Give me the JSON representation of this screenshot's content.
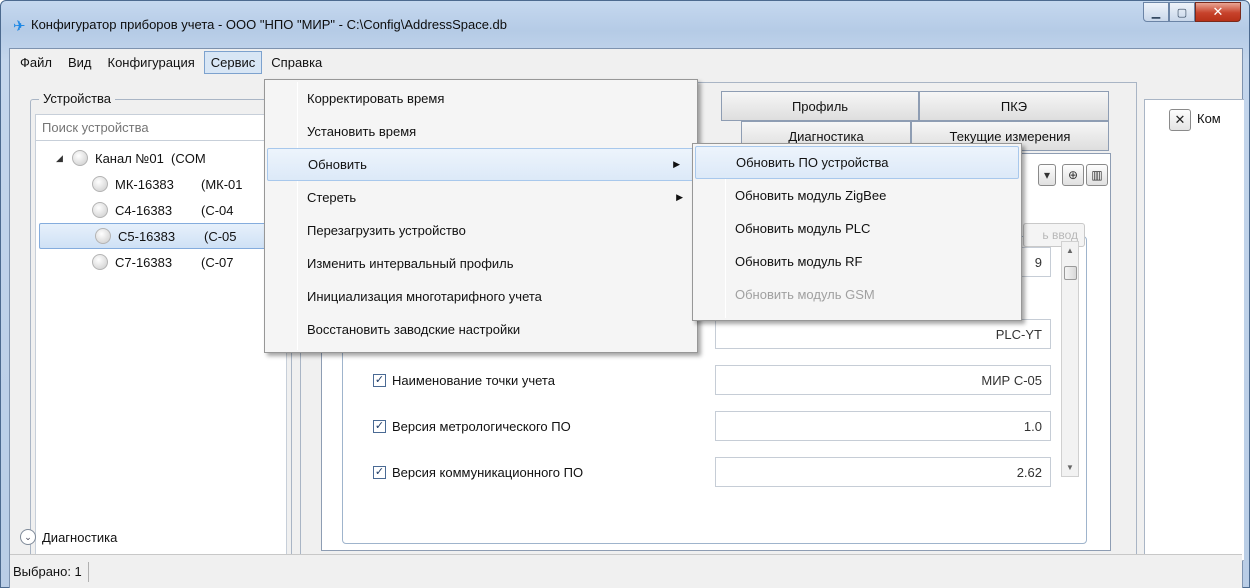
{
  "window": {
    "title": "Конфигуратор приборов учета - ООО \"НПО \"МИР\" - C:\\Config\\AddressSpace.db",
    "minimize_glyph": "▁",
    "maximize_glyph": "▢",
    "close_glyph": "✕"
  },
  "menubar": [
    "Файл",
    "Вид",
    "Конфигурация",
    "Сервис",
    "Справка"
  ],
  "devices": {
    "group_label": "Устройства",
    "search_placeholder": "Поиск устройства",
    "channel": {
      "name": "Канал №01",
      "port": "(COM"
    },
    "items": [
      {
        "name": "МК-16383",
        "port": "(МК-01"
      },
      {
        "name": "С4-16383",
        "port": "(С-04"
      },
      {
        "name": "С5-16383",
        "port": "(С-05",
        "selected": true
      },
      {
        "name": "С7-16383",
        "port": "(С-07"
      }
    ]
  },
  "tabs": {
    "row1": [
      "Профиль",
      "ПКЭ"
    ],
    "row2": [
      "Диагностика",
      "Текущие измерения"
    ]
  },
  "panel": {
    "input_button": "ь ввод",
    "partial_value_1": "9",
    "partial_value_2": "PLC-YT",
    "params": [
      {
        "label": "Наименование точки учета",
        "value": "МИР С-05",
        "checked": true
      },
      {
        "label": "Версия метрологического ПО",
        "value": "1.0",
        "checked": true
      },
      {
        "label": "Версия коммуникационного ПО",
        "value": "2.62",
        "checked": true
      }
    ]
  },
  "right_panel": {
    "label": "Ком"
  },
  "service_menu": [
    {
      "label": "Корректировать время"
    },
    {
      "label": "Установить время"
    },
    {
      "label": "Обновить",
      "submenu": true,
      "highlighted": true
    },
    {
      "label": "Стереть",
      "submenu": true
    },
    {
      "label": "Перезагрузить устройство"
    },
    {
      "label": "Изменить интервальный профиль"
    },
    {
      "label": "Инициализация многотарифного учета"
    },
    {
      "label": "Восстановить заводские настройки"
    }
  ],
  "update_submenu": [
    {
      "label": "Обновить ПО устройства",
      "highlighted": true
    },
    {
      "label": "Обновить модуль ZigBee"
    },
    {
      "label": "Обновить модуль PLC"
    },
    {
      "label": "Обновить модуль RF"
    },
    {
      "label": "Обновить модуль GSM",
      "disabled": true
    }
  ],
  "diagnostics_label": "Диагностика",
  "status": {
    "selected": "Выбрано: 1"
  },
  "icons": {
    "app": "app-icon",
    "add": "add-icon",
    "delete": "trash-icon",
    "close": "close-icon",
    "expand": "chevron-down-icon",
    "submenu": "chevron-right-icon"
  },
  "colors": {
    "menu_highlight": "#dce9f8",
    "selection": "#cfe1f5",
    "close_button": "#c7422b"
  }
}
